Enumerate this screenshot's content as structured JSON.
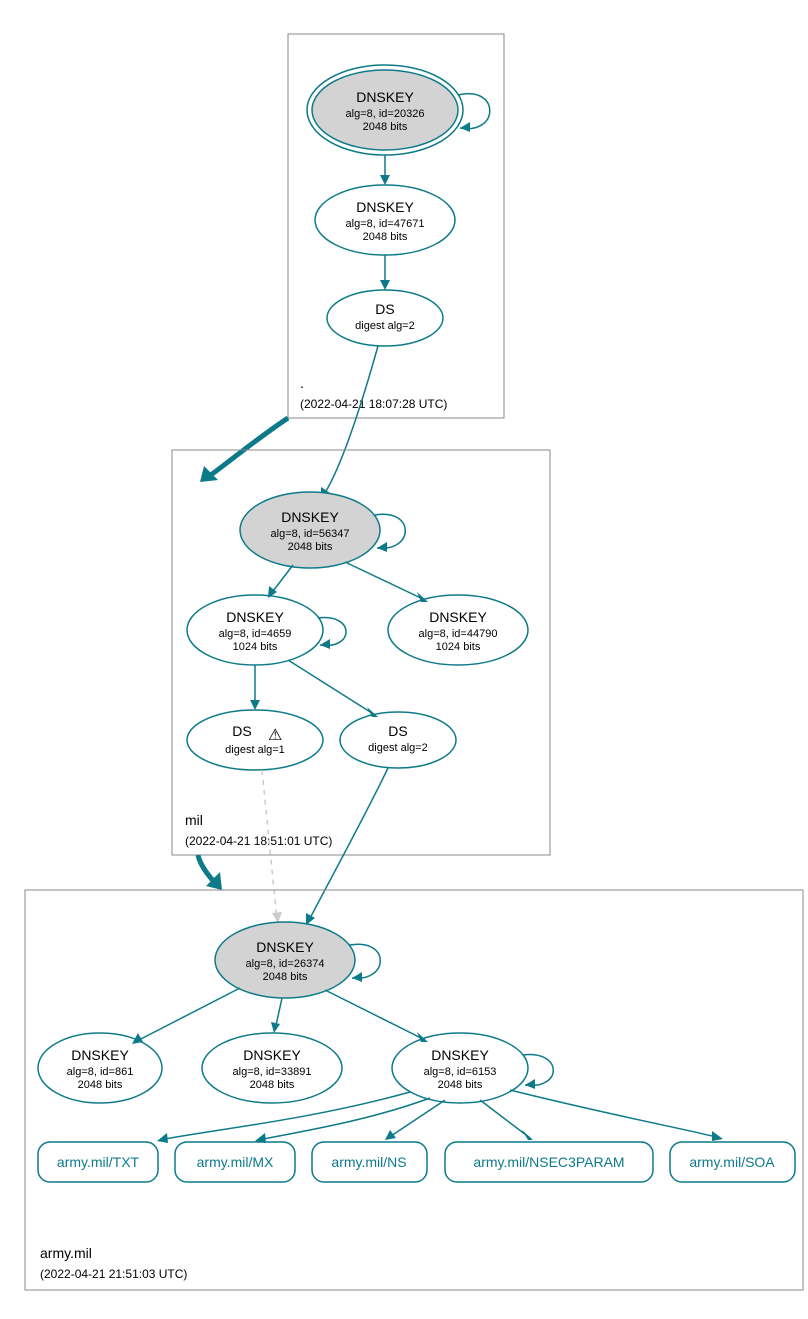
{
  "zones": {
    "root": {
      "label": ".",
      "date": "(2022-04-21 18:07:28 UTC)"
    },
    "mil": {
      "label": "mil",
      "date": "(2022-04-21 18:51:01 UTC)"
    },
    "army": {
      "label": "army.mil",
      "date": "(2022-04-21 21:51:03 UTC)"
    }
  },
  "nodes": {
    "root_ksk": {
      "title": "DNSKEY",
      "l1": "alg=8, id=20326",
      "l2": "2048 bits"
    },
    "root_zsk": {
      "title": "DNSKEY",
      "l1": "alg=8, id=47671",
      "l2": "2048 bits"
    },
    "root_ds": {
      "title": "DS",
      "l1": "digest alg=2"
    },
    "mil_ksk": {
      "title": "DNSKEY",
      "l1": "alg=8, id=56347",
      "l2": "2048 bits"
    },
    "mil_zsk1": {
      "title": "DNSKEY",
      "l1": "alg=8, id=4659",
      "l2": "1024 bits"
    },
    "mil_zsk2": {
      "title": "DNSKEY",
      "l1": "alg=8, id=44790",
      "l2": "1024 bits"
    },
    "mil_ds1": {
      "title": "DS",
      "l1": "digest alg=1"
    },
    "mil_ds2": {
      "title": "DS",
      "l1": "digest alg=2"
    },
    "army_ksk": {
      "title": "DNSKEY",
      "l1": "alg=8, id=26374",
      "l2": "2048 bits"
    },
    "army_k1": {
      "title": "DNSKEY",
      "l1": "alg=8, id=861",
      "l2": "2048 bits"
    },
    "army_k2": {
      "title": "DNSKEY",
      "l1": "alg=8, id=33891",
      "l2": "2048 bits"
    },
    "army_k3": {
      "title": "DNSKEY",
      "l1": "alg=8, id=6153",
      "l2": "2048 bits"
    }
  },
  "rr": {
    "txt": "army.mil/TXT",
    "mx": "army.mil/MX",
    "ns": "army.mil/NS",
    "nsec3": "army.mil/NSEC3PARAM",
    "soa": "army.mil/SOA"
  },
  "warn_icon": "⚠"
}
